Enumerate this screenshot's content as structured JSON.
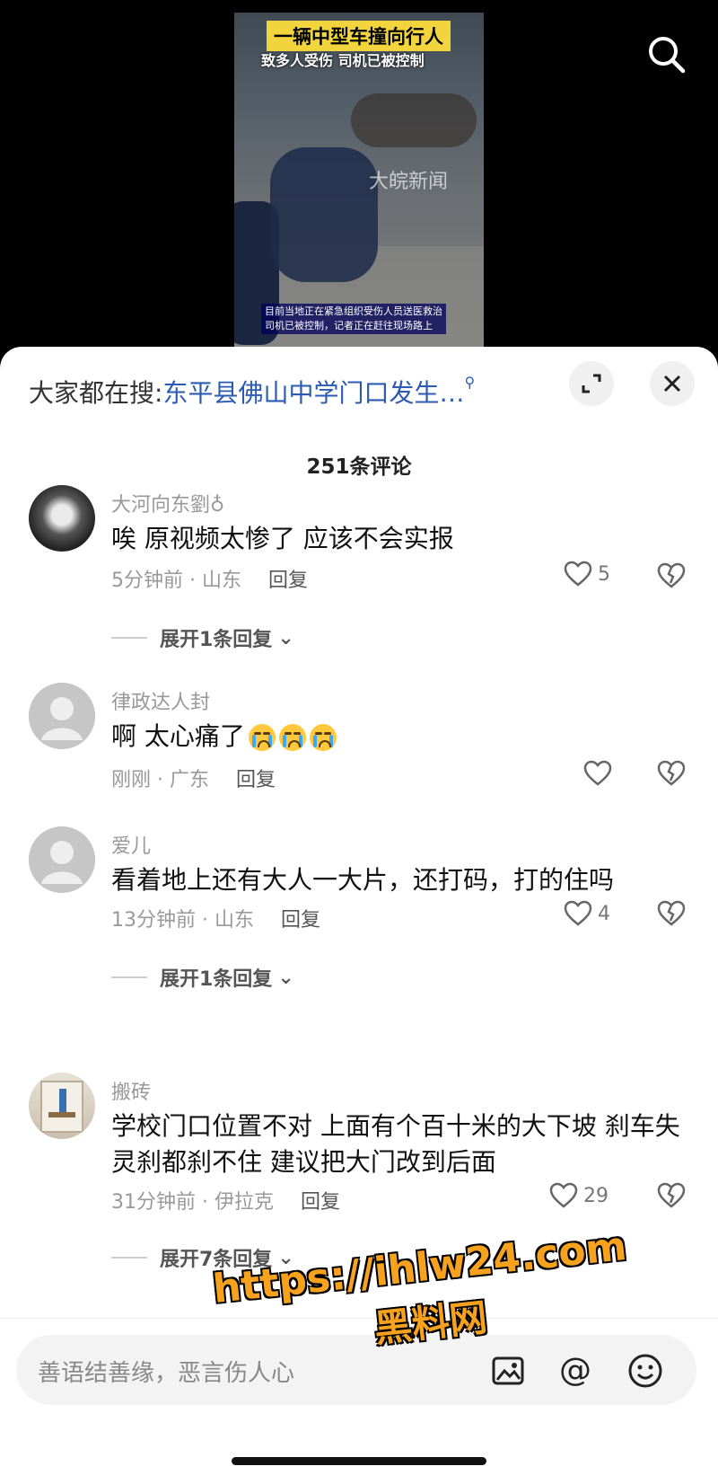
{
  "video": {
    "title_line1": "一辆中型车撞向行人",
    "title_line2": "致多人受伤 司机已被控制",
    "watermark": "大皖新闻",
    "caption_line1": "目前当地正在紧急组织受伤人员送医救治",
    "caption_line2": "司机已被控制，记者正在赶往现场路上"
  },
  "sheet": {
    "hot_prefix": "大家都在搜:",
    "hot_query": "东平县佛山中学门口发生…",
    "count": "251条评论"
  },
  "comments": [
    {
      "name": "大河向东劉♁",
      "text": "唉  原视频太惨了  应该不会实报",
      "time": "5分钟前 · 山东",
      "reply": "回复",
      "likes": "5",
      "expand": "展开1条回复"
    },
    {
      "name": "律政达人封",
      "text": "啊 太心痛了",
      "time": "刚刚 · 广东",
      "reply": "回复",
      "likes": ""
    },
    {
      "name": "爱儿",
      "text": "看着地上还有大人一大片，还打码，打的住吗",
      "time": "13分钟前 · 山东",
      "reply": "回复",
      "likes": "4",
      "expand": "展开1条回复"
    },
    {
      "name": "搬砖",
      "text": "学校门口位置不对 上面有个百十米的大下坡 刹车失灵刹都刹不住 建议把大门改到后面",
      "time": "31分钟前 · 伊拉克",
      "reply": "回复",
      "likes": "29",
      "expand": "展开7条回复"
    }
  ],
  "input": {
    "placeholder": "善语结善缘，恶言伤人心"
  },
  "overlay": {
    "url": "https://ihlw24.com",
    "site": "黑料网"
  },
  "colors": {
    "accent": "#2c5bb3",
    "overlay": "#f6a21e"
  }
}
